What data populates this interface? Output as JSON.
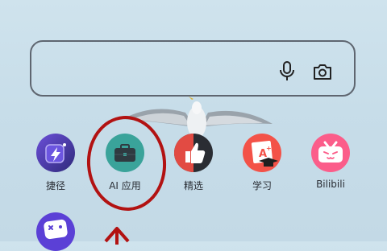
{
  "search": {
    "mic_icon": "microphone-icon",
    "camera_icon": "camera-icon"
  },
  "apps": [
    {
      "label": "捷径",
      "icon": "shortcuts-icon"
    },
    {
      "label": "AI 应用",
      "icon": "toolbox-icon"
    },
    {
      "label": "精选",
      "icon": "thumbs-up-icon"
    },
    {
      "label": "学习",
      "icon": "study-icon"
    },
    {
      "label": "Bilibili",
      "icon": "bilibili-icon"
    }
  ],
  "partial_app": {
    "icon": "game-controller-icon"
  },
  "colors": {
    "annotation": "#b21212",
    "ai_tile": "#3aa39a",
    "shortcuts_tile": "#4a3aa8",
    "learn_tile": "#f35248",
    "bilibili_tile": "#fb5d8a"
  }
}
